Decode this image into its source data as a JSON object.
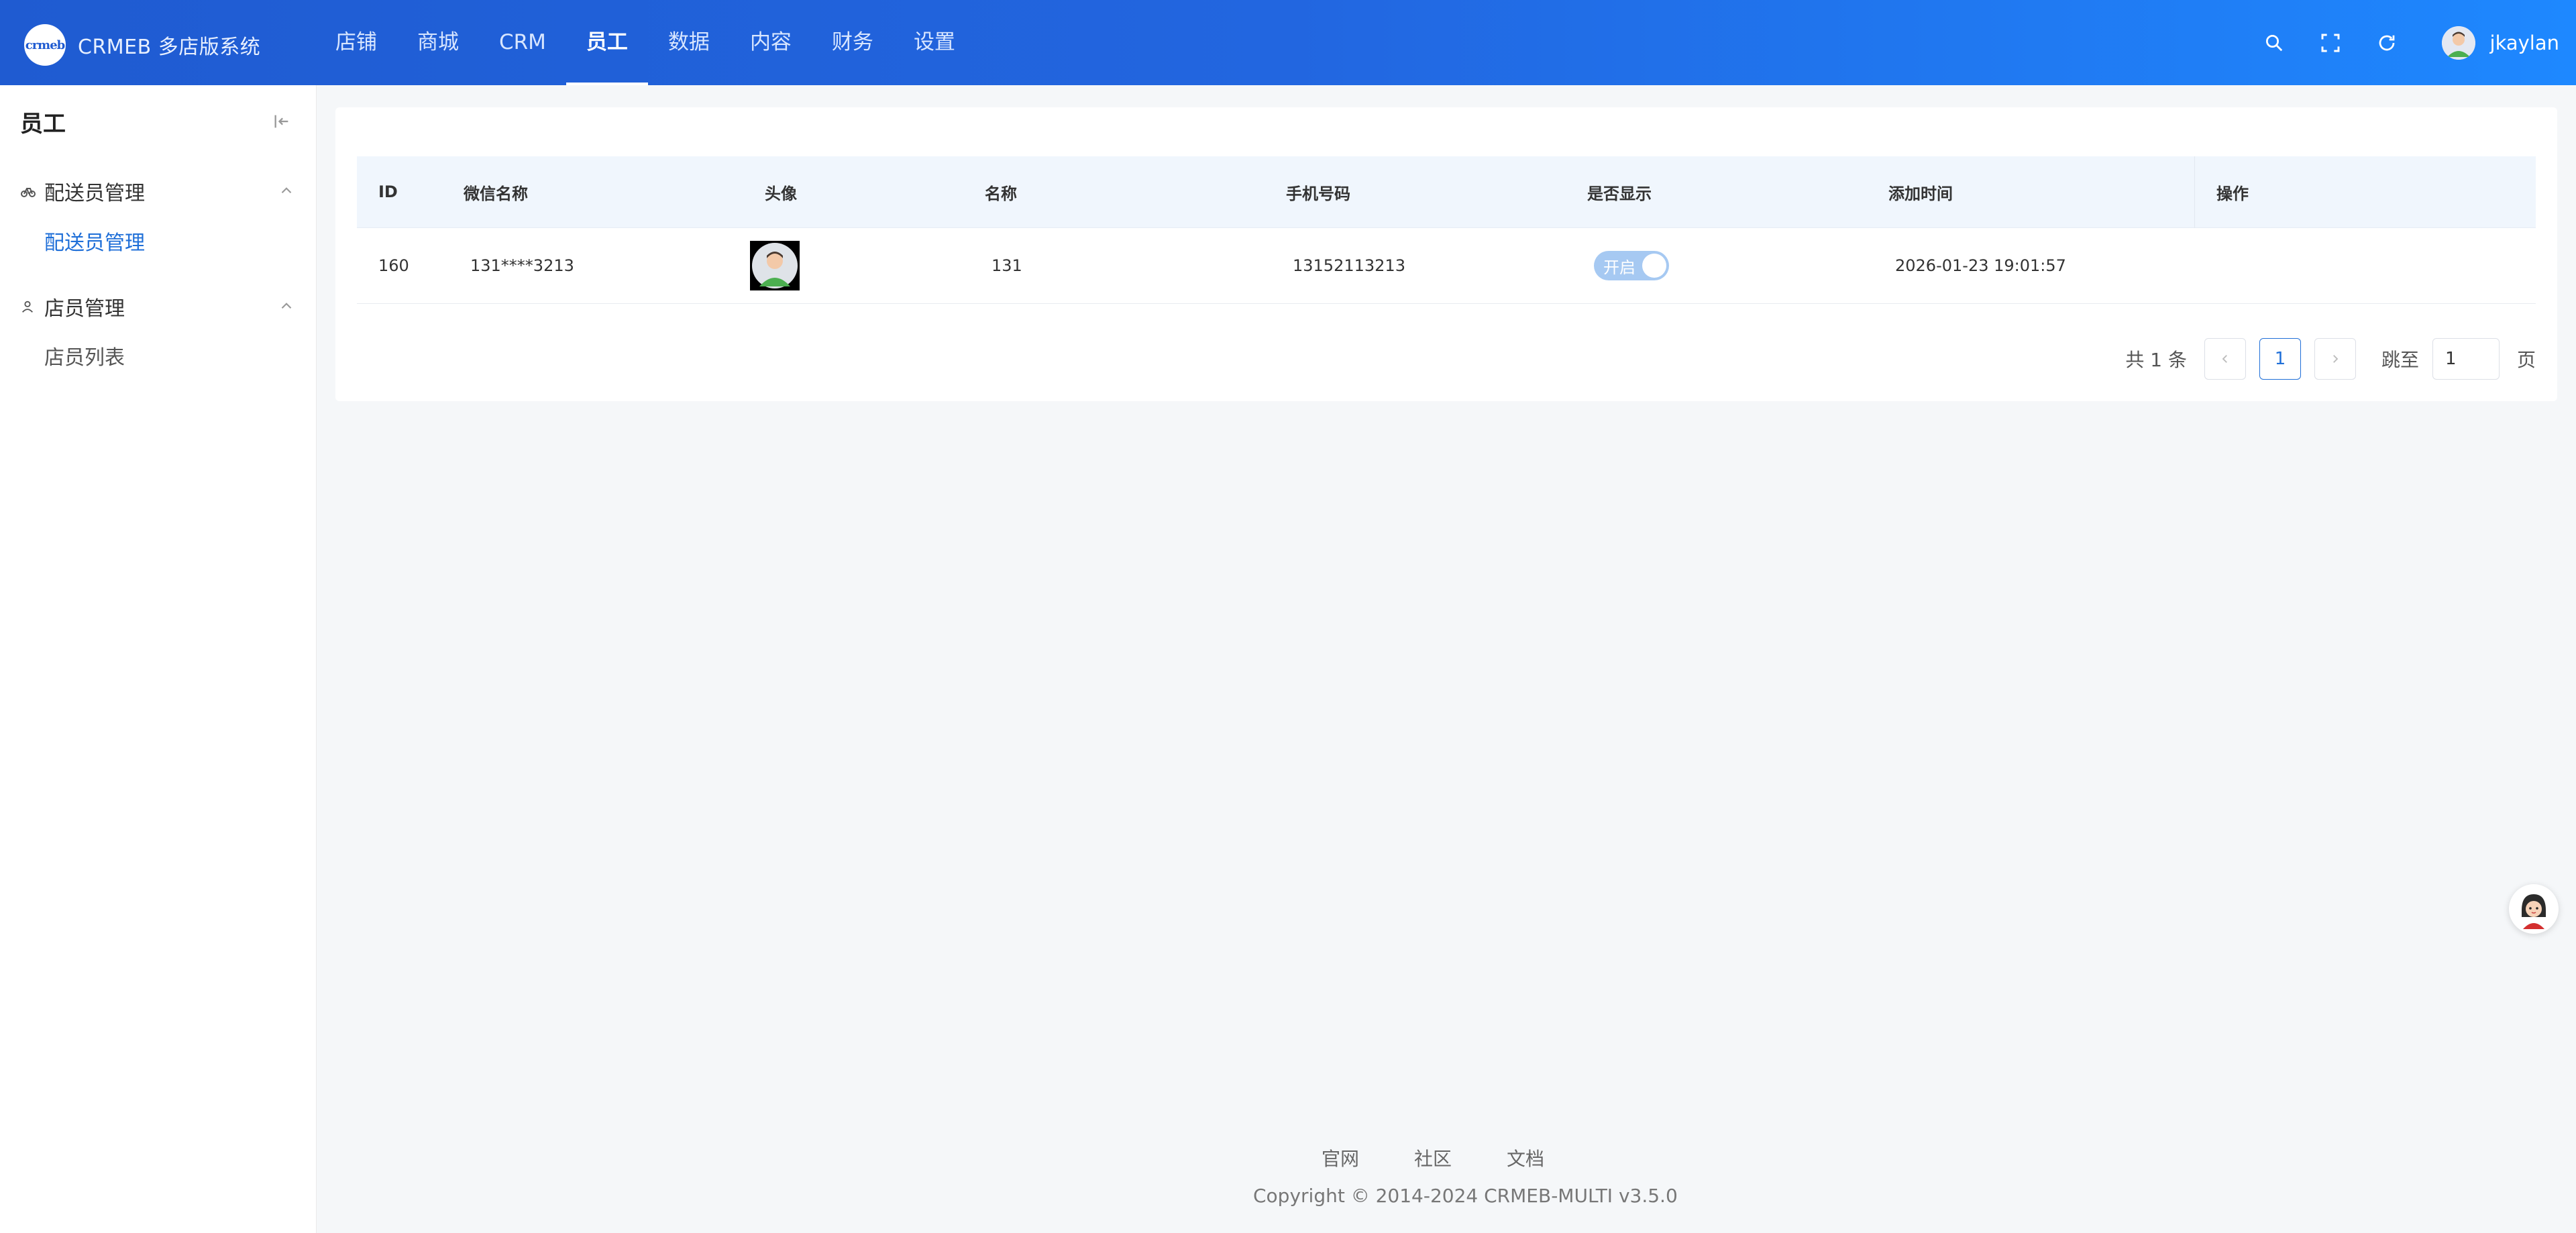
{
  "brand": {
    "name": "CRMEB 多店版系统",
    "logo_text": "crmeb"
  },
  "topnav": [
    {
      "label": "店铺"
    },
    {
      "label": "商城"
    },
    {
      "label": "CRM"
    },
    {
      "label": "员工",
      "active": true
    },
    {
      "label": "数据"
    },
    {
      "label": "内容"
    },
    {
      "label": "财务"
    },
    {
      "label": "设置"
    }
  ],
  "topright": {
    "icons": [
      "search-icon",
      "fullscreen-icon",
      "refresh-icon"
    ],
    "username": "jkaylan"
  },
  "sidebar": {
    "title": "员工",
    "groups": [
      {
        "label": "配送员管理",
        "icon": "bicycle-icon",
        "items": [
          {
            "label": "配送员管理",
            "active": true
          }
        ]
      },
      {
        "label": "店员管理",
        "icon": "user-icon",
        "items": [
          {
            "label": "店员列表"
          }
        ]
      }
    ]
  },
  "table": {
    "columns": [
      "ID",
      "微信名称",
      "头像",
      "名称",
      "手机号码",
      "是否显示",
      "添加时间",
      "操作"
    ],
    "rows": [
      {
        "id": "160",
        "wechat_name": "131****3213",
        "name": "131",
        "phone": "13152113213",
        "show": "开启",
        "created": "2026-01-23 19:01:57",
        "actions": ""
      }
    ]
  },
  "pagination": {
    "total_text": "共 1 条",
    "current_page": "1",
    "jump_label": "跳至",
    "jump_value": "1",
    "page_unit": "页"
  },
  "footer": {
    "links": [
      "官网",
      "社区",
      "文档"
    ],
    "copyright": "Copyright © 2014-2024 CRMEB-MULTI v3.5.0"
  },
  "colors": {
    "header_start": "#1f5bd1",
    "header_end": "#1e88ff",
    "accent": "#1f6fd8",
    "switch_on": "#a6c9f2"
  }
}
